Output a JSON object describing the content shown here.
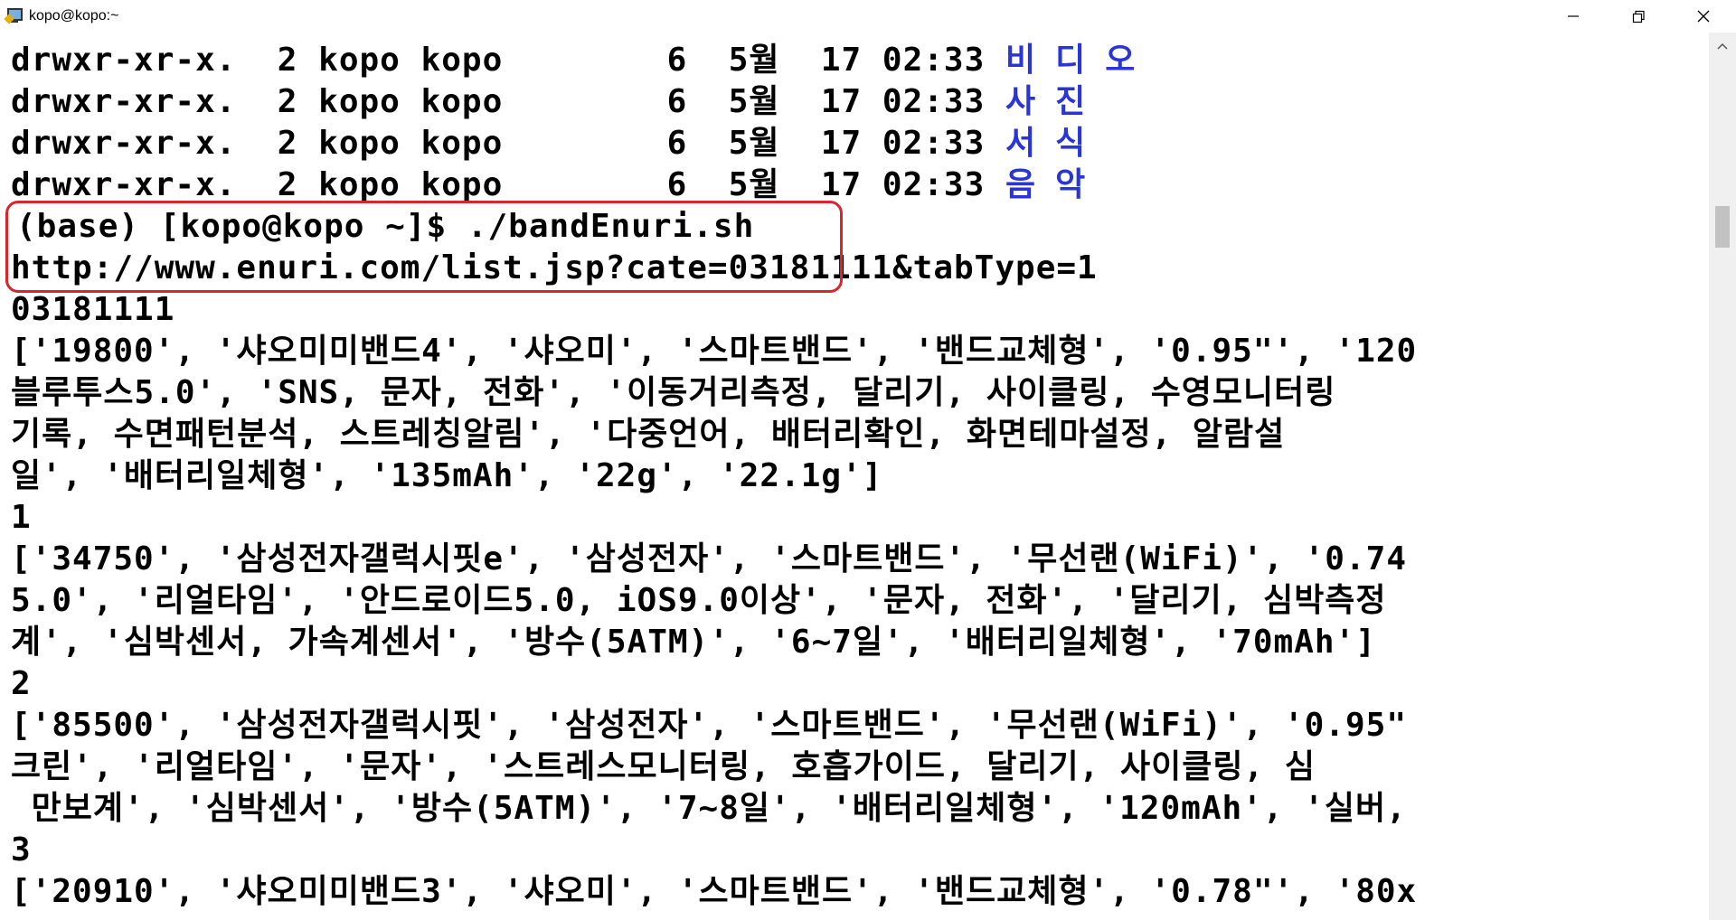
{
  "window": {
    "title": "kopo@kopo:~",
    "app_icon": "putty-terminal-icon",
    "controls": [
      "minimize-icon",
      "restore-icon",
      "close-icon"
    ]
  },
  "colors": {
    "directory_name": "#2a35d8",
    "highlight_box": "#d7262e",
    "background": "#ffffff",
    "text": "#000000"
  },
  "terminal": {
    "listing": [
      {
        "perms": "drwxr-xr-x.",
        "links": "2",
        "owner": "kopo",
        "group": "kopo",
        "size": "6",
        "month": "5월",
        "day": "17",
        "time": "02:33",
        "name": "비디오"
      },
      {
        "perms": "drwxr-xr-x.",
        "links": "2",
        "owner": "kopo",
        "group": "kopo",
        "size": "6",
        "month": "5월",
        "day": "17",
        "time": "02:33",
        "name": "사진"
      },
      {
        "perms": "drwxr-xr-x.",
        "links": "2",
        "owner": "kopo",
        "group": "kopo",
        "size": "6",
        "month": "5월",
        "day": "17",
        "time": "02:33",
        "name": "서식"
      },
      {
        "perms": "drwxr-xr-x.",
        "links": "2",
        "owner": "kopo",
        "group": "kopo",
        "size": "6",
        "month": "5월",
        "day": "17",
        "time": "02:33",
        "name": "음악"
      }
    ],
    "prompt": "(base) [kopo@kopo ~]$ ./bandEnuri.sh",
    "output": [
      "http://www.enuri.com/list.jsp?cate=03181111&tabType=1",
      "03181111",
      "['19800', '샤오미미밴드4', '샤오미', '스마트밴드', '밴드교체형', '0.95\"', '120",
      "블루투스5.0', 'SNS, 문자, 전화', '이동거리측정, 달리기, 사이클링, 수영모니터링",
      "기록, 수면패턴분석, 스트레칭알림', '다중언어, 배터리확인, 화면테마설정, 알람설",
      "일', '배터리일체형', '135mAh', '22g', '22.1g']",
      "1",
      "['34750', '삼성전자갤럭시핏e', '삼성전자', '스마트밴드', '무선랜(WiFi)', '0.74",
      "5.0', '리얼타임', '안드로이드5.0, iOS9.0이상', '문자, 전화', '달리기, 심박측정",
      "계', '심박센서, 가속계센서', '방수(5ATM)', '6~7일', '배터리일체형', '70mAh']",
      "2",
      "['85500', '삼성전자갤럭시핏', '삼성전자', '스마트밴드', '무선랜(WiFi)', '0.95\"",
      "크린', '리얼타임', '문자', '스트레스모니터링, 호흡가이드, 달리기, 사이클링, 심",
      " 만보계', '심박센서', '방수(5ATM)', '7~8일', '배터리일체형', '120mAh', '실버,",
      "3",
      "['20910', '샤오미미밴드3', '샤오미', '스마트밴드', '밴드교체형', '0.78\"', '80x"
    ]
  }
}
